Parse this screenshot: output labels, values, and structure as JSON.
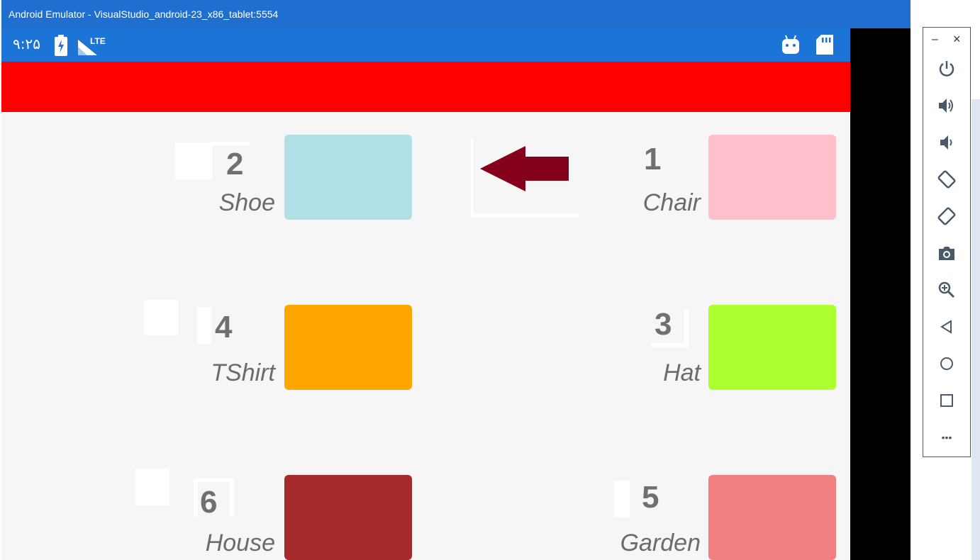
{
  "window": {
    "title": "Android Emulator - VisualStudio_android-23_x86_tablet:5554"
  },
  "statusbar": {
    "time": "۹:۲۵",
    "network_label": "LTE"
  },
  "colors": {
    "titlebar": "#1e6fd0",
    "statusbar": "#1c74d6",
    "toolbar": "#ff0000",
    "arrow": "#85001a",
    "text": "#6b6b6b"
  },
  "items": [
    {
      "num": "1",
      "label": "Chair",
      "color": "#ffc0cb"
    },
    {
      "num": "2",
      "label": "Shoe",
      "color": "#b0dfe5"
    },
    {
      "num": "3",
      "label": "Hat",
      "color": "#adff2f"
    },
    {
      "num": "4",
      "label": "TShirt",
      "color": "#ffa500"
    },
    {
      "num": "5",
      "label": "Garden",
      "color": "#f08080"
    },
    {
      "num": "6",
      "label": "House",
      "color": "#a52a2a"
    }
  ],
  "side_toolbar": {
    "minimize": "–",
    "close": "×",
    "buttons": [
      "power-icon",
      "volume-up-icon",
      "volume-down-icon",
      "rotate-left-icon",
      "rotate-right-icon",
      "camera-icon",
      "zoom-icon",
      "back-icon",
      "home-icon",
      "overview-icon",
      "more-icon"
    ],
    "more_label": "•••"
  }
}
